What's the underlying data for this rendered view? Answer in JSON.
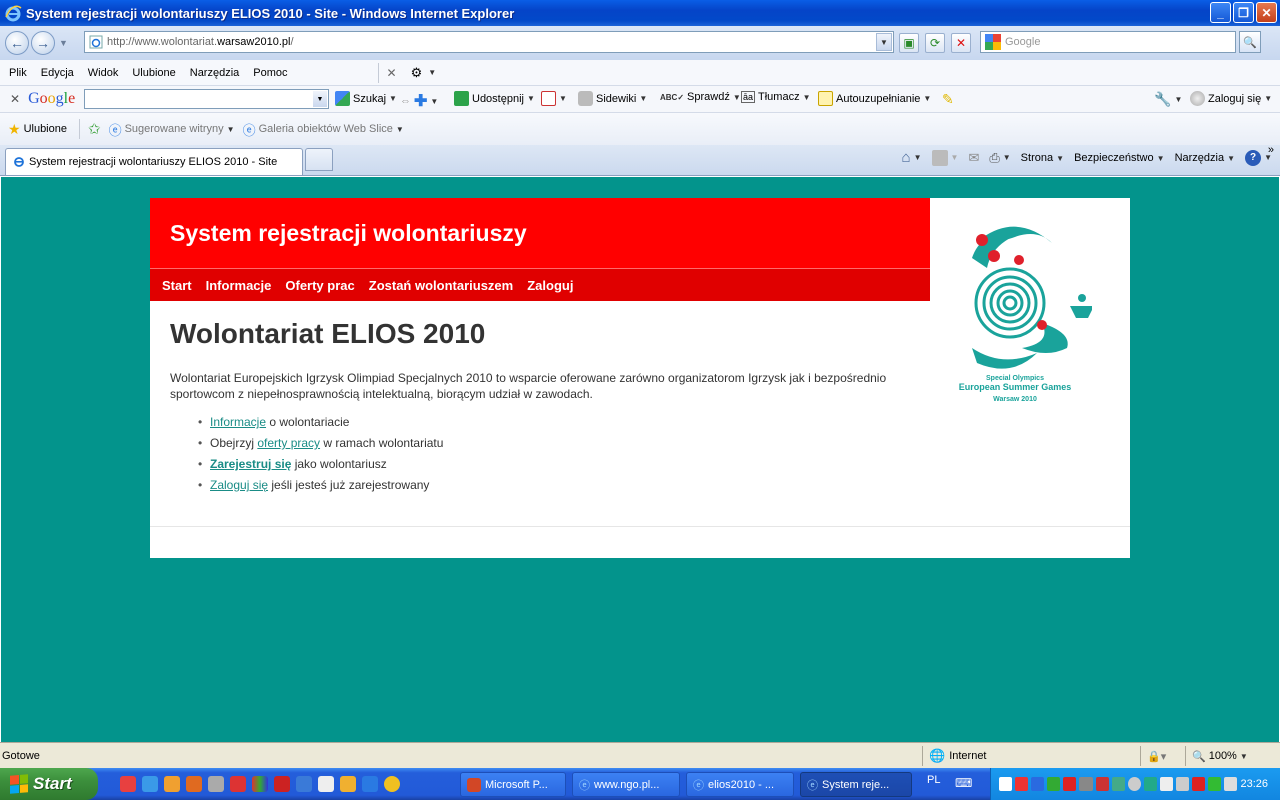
{
  "window": {
    "title": "System rejestracji wolontariuszy ELIOS 2010 - Site - Windows Internet Explorer"
  },
  "address": {
    "url_prefix": "http://www.wolontariat.",
    "url_domain": "warsaw2010.pl",
    "url_suffix": "/"
  },
  "search": {
    "placeholder": "Google"
  },
  "menu": [
    "Plik",
    "Edycja",
    "Widok",
    "Ulubione",
    "Narzędzia",
    "Pomoc"
  ],
  "google_toolbar": {
    "search_label": "Szukaj",
    "share_label": "Udostępnij",
    "sidewiki_label": "Sidewiki",
    "check_label": "Sprawdź",
    "translate_label": "Tłumacz",
    "autofill_label": "Autouzupełnianie",
    "signin_label": "Zaloguj się"
  },
  "favorites": {
    "favorites_label": "Ulubione",
    "suggested_label": "Sugerowane witryny",
    "webslice_label": "Galeria obiektów Web Slice"
  },
  "tab": {
    "title": "System rejestracji wolontariuszy ELIOS 2010 - Site"
  },
  "command_bar": {
    "page_label": "Strona",
    "security_label": "Bezpieczeństwo",
    "tools_label": "Narzędzia"
  },
  "site": {
    "header_title": "System rejestracji wolontariuszy",
    "nav": [
      "Start",
      "Informacje",
      "Oferty prac",
      "Zostań wolontariuszem",
      "Zaloguj"
    ],
    "heading": "Wolontariat ELIOS 2010",
    "intro": "Wolontariat Europejskich Igrzysk Olimpiad Specjalnych 2010 to wsparcie oferowane zarówno organizatorom Igrzysk jak i bezpośrednio sportowcom z niepełnosprawnością intelektualną, biorącym udział w zawodach.",
    "links": [
      {
        "pre": "",
        "link": "Informacje",
        "post": " o wolontariacie"
      },
      {
        "pre": "Obejrzyj ",
        "link": "oferty pracy",
        "post": " w ramach wolontariatu"
      },
      {
        "pre": "",
        "link": "Zarejestruj się",
        "post": " jako wolontariusz"
      },
      {
        "pre": "",
        "link": "Zaloguj się",
        "post": " jeśli jesteś już zarejestrowany"
      }
    ],
    "logo_text": {
      "line1": "Special Olympics",
      "line2": "European Summer Games",
      "line3": "Warsaw 2010"
    },
    "colors": {
      "background": "#03948c",
      "header": "#ff0000",
      "nav": "#e00000",
      "link": "#1a8c86"
    }
  },
  "status": {
    "text": "Gotowe",
    "zone": "Internet",
    "zoom": "100%"
  },
  "taskbar": {
    "start_label": "Start",
    "buttons": [
      "Microsoft P...",
      "www.ngo.pl...",
      "elios2010 - ...",
      "System reje..."
    ],
    "language": "PL",
    "clock": "23:26"
  }
}
